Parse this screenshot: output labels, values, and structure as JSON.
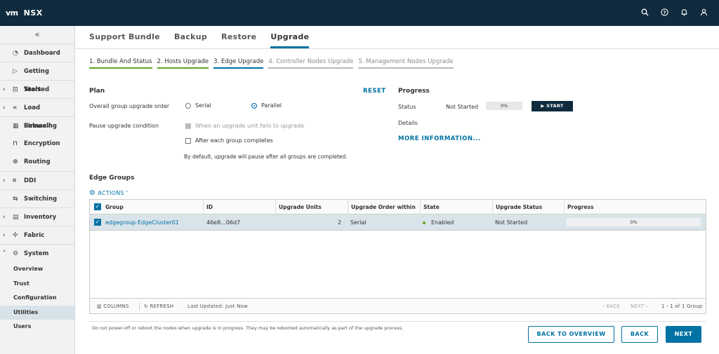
{
  "header": {
    "logo": "vm",
    "app_name": "NSX",
    "icons": [
      "search-icon",
      "help-icon",
      "bell-icon",
      "user-icon"
    ]
  },
  "sidebar": {
    "collapse_label": "«",
    "items": [
      {
        "label": "Dashboard",
        "icon": "dashboard-icon",
        "expandable": false
      },
      {
        "label": "Getting Started",
        "icon": "play-icon",
        "expandable": false
      },
      {
        "label": "Tools",
        "icon": "tools-icon",
        "expandable": true
      },
      {
        "label": "Load Balancing",
        "icon": "load-balancer-icon",
        "expandable": true
      },
      {
        "label": "Firewall",
        "icon": "firewall-icon",
        "expandable": false
      },
      {
        "label": "Encryption",
        "icon": "lock-icon",
        "expandable": false
      },
      {
        "label": "Routing",
        "icon": "routing-icon",
        "expandable": false
      },
      {
        "label": "DDI",
        "icon": "ddi-icon",
        "expandable": true
      },
      {
        "label": "Switching",
        "icon": "switching-icon",
        "expandable": false
      },
      {
        "label": "Inventory",
        "icon": "inventory-icon",
        "expandable": true
      },
      {
        "label": "Fabric",
        "icon": "fabric-icon",
        "expandable": true
      },
      {
        "label": "System",
        "icon": "gear-icon",
        "expandable": true
      }
    ],
    "system_sub": [
      "Overview",
      "Trust",
      "Configuration",
      "Utilities",
      "Users"
    ],
    "active_sub": "Utilities"
  },
  "tabs": [
    "Support Bundle",
    "Backup",
    "Restore",
    "Upgrade"
  ],
  "active_tab": "Upgrade",
  "steps": [
    {
      "label": "1. Bundle And Status",
      "state": "done"
    },
    {
      "label": "2. Hosts Upgrade",
      "state": "done"
    },
    {
      "label": "3. Edge Upgrade",
      "state": "current"
    },
    {
      "label": "4. Controller Nodes Upgrade",
      "state": "todo"
    },
    {
      "label": "5. Management Nodes Upgrade",
      "state": "todo"
    }
  ],
  "plan": {
    "title": "Plan",
    "reset": "RESET",
    "order_label": "Overall group upgrade order",
    "serial": "Serial",
    "parallel": "Parallel",
    "selected_order": "Parallel",
    "pause_label": "Pause upgrade condition",
    "pause_fail": "When an upgrade unit fails to upgrade",
    "pause_after": "After each group completes",
    "note": "By default, upgrade will pause after all groups are completed."
  },
  "progress": {
    "title": "Progress",
    "status_label": "Status",
    "status_value": "Not Started",
    "percent": "0%",
    "start_button": "▶ START",
    "details_label": "Details",
    "more_info": "MORE INFORMATION..."
  },
  "edge_groups": {
    "title": "Edge Groups",
    "actions": "ACTIONS",
    "columns": [
      "Group",
      "ID",
      "Upgrade Units",
      "Upgrade Order within Gr",
      "State",
      "Upgrade Status",
      "Progress"
    ],
    "rows": [
      {
        "group": "edgegroup-EdgeCluster01",
        "id": "46e8...06d7",
        "units": "2",
        "order": "Serial",
        "state": "Enabled",
        "status": "Not Started",
        "progress": "0%"
      }
    ],
    "footer": {
      "columns": "COLUMNS",
      "refresh": "REFRESH",
      "last_updated": "Last Updated: Just Now",
      "back": "‹ BACK",
      "next": "NEXT ›",
      "count": "1 - 1 of 1 Group"
    }
  },
  "footer_note": "Do not power-off or reboot the nodes when upgrade is in progress. They may be rebooted automatically as part of the upgrade process.",
  "buttons": {
    "back_to_overview": "BACK TO OVERVIEW",
    "back": "BACK",
    "next": "NEXT"
  },
  "colors": {
    "header_bg": "#0f2b3d",
    "accent": "#0072a3",
    "done_green": "#62a420",
    "selected_row": "#d9e4ea"
  }
}
